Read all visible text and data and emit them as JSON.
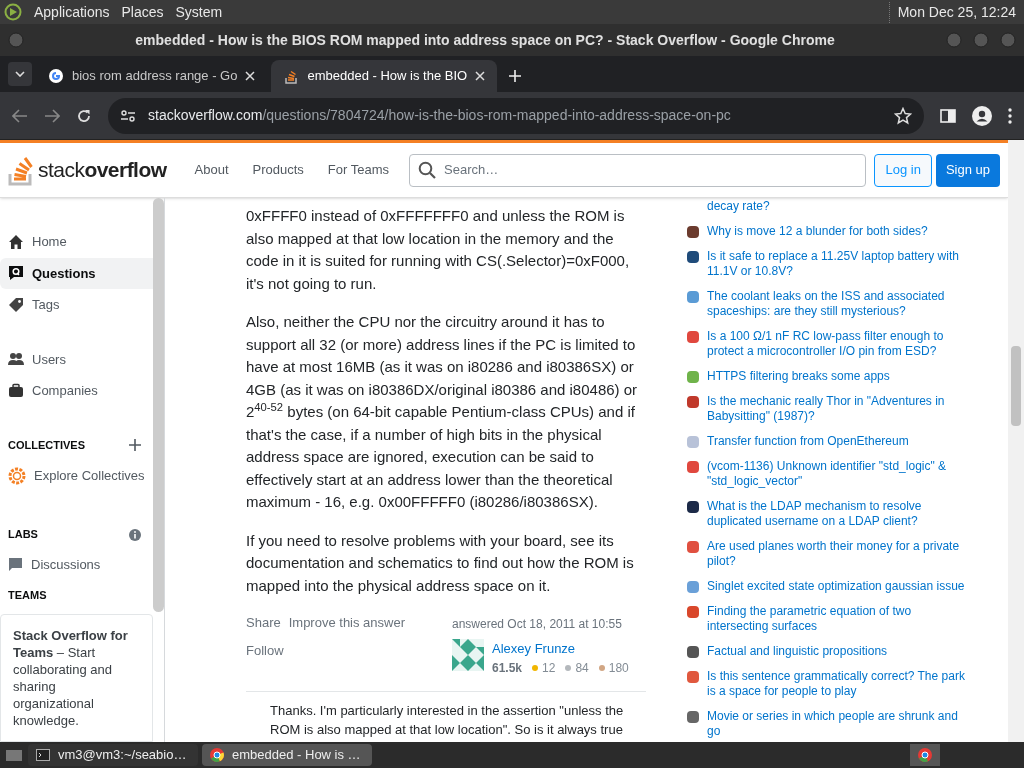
{
  "desktop_bar": {
    "menus": [
      "Applications",
      "Places",
      "System"
    ],
    "clock": "Mon Dec 25, 12:24"
  },
  "window": {
    "title": "embedded - How is the BIOS ROM mapped into address space on PC? - Stack Overflow - Google Chrome"
  },
  "tabs": [
    {
      "label": "bios rom address range - Go",
      "selected": false,
      "kind": "google"
    },
    {
      "label": "embedded - How is the BIO",
      "selected": true,
      "kind": "so"
    }
  ],
  "address_bar": {
    "host": "stackoverflow.com",
    "path": "/questions/7804724/how-is-the-bios-rom-mapped-into-address-space-on-pc"
  },
  "header": {
    "logo_light": "stack",
    "logo_bold": "overflow",
    "nav": [
      "About",
      "Products",
      "For Teams"
    ],
    "search_placeholder": "Search…",
    "login": "Log in",
    "signup": "Sign up"
  },
  "sidebar": {
    "items": [
      {
        "label": "Home",
        "selected": false
      },
      {
        "label": "Questions",
        "selected": true
      },
      {
        "label": "Tags",
        "selected": false
      },
      {
        "label": "Users",
        "selected": false
      },
      {
        "label": "Companies",
        "selected": false
      }
    ],
    "collectives_heading": "COLLECTIVES",
    "explore": "Explore Collectives",
    "labs_heading": "LABS",
    "discussions": "Discussions",
    "teams_heading": "TEAMS",
    "teams_text": "**Stack Overflow for Teams** – Start collaborating and sharing organizational knowledge."
  },
  "answer": {
    "paragraphs": [
      "0xFFFF0 instead of 0xFFFFFFF0 and unless the ROM is also mapped at that low location in the memory and the code in it is suited for running with CS(.Selector)=0xF000, it's not going to run.",
      "Also, neither the CPU nor the circuitry around it has to support all 32 (or more) address lines if the PC is limited to have at most 16MB (as it was on i80286 and i80386SX) or 4GB (as it was on i80386DX/original i80386 and i80486) or 2$^{40-52}$ bytes (on 64-bit capable Pentium-class CPUs) and if that's the case, if a number of high bits in the physical address space are ignored, execution can be said to effectively start at an address lower than the theoretical maximum - 16, e.g. 0x00FFFFF0 (i80286/i80386SX).",
      "If you need to resolve problems with your board, see its documentation and schematics to find out how the ROM is mapped into the physical address space on it."
    ],
    "actions": [
      "Share",
      "Improve this answer",
      "Follow"
    ],
    "answered": "answered Oct 18, 2011 at 10:55",
    "author": "Alexey Frunze",
    "reputation": "61.5k",
    "gold": "12",
    "silver": "84",
    "bronze": "180",
    "comment": "Thanks. I'm particularly interested in the assertion \"unless the ROM is also mapped at that low location\". So is it always true"
  },
  "hot_questions": [
    {
      "title": "decay rate?"
    },
    {
      "title": "Why is move 12 a blunder for both sides?",
      "color": "#6b3b2e"
    },
    {
      "title": "Is it safe to replace a 11.25V laptop battery with 11.1V or 10.8V?",
      "color": "#1f4b7a"
    },
    {
      "title": "The coolant leaks on the ISS and associated spaceships: are they still mysterious?",
      "color": "#5a9bd5"
    },
    {
      "title": "Is a 100 Ω/1 nF RC low-pass filter enough to protect a microcontroller I/O pin from ESD?",
      "color": "#e0483e"
    },
    {
      "title": "HTTPS filtering breaks some apps",
      "color": "#6fb34a"
    },
    {
      "title": "Is the mechanic really Thor in \"Adventures in Babysitting\" (1987)?",
      "color": "#c0392b"
    },
    {
      "title": "Transfer function from OpenEthereum",
      "color": "#b8c2d8"
    },
    {
      "title": "(vcom-1136) Unknown identifier \"std_logic\" & \"std_logic_vector\"",
      "color": "#e0483e"
    },
    {
      "title": "What is the LDAP mechanism to resolve duplicated username on a LDAP client?",
      "color": "#1c2a48"
    },
    {
      "title": "Are used planes worth their money for a private pilot?",
      "color": "#e05040"
    },
    {
      "title": "Singlet excited state optimization gaussian issue",
      "color": "#6aa0d8"
    },
    {
      "title": "Finding the parametric equation of two intersecting surfaces",
      "color": "#d9472b"
    },
    {
      "title": "Factual and linguistic propositions",
      "color": "#555555"
    },
    {
      "title": "Is this sentence grammatically correct? The park is a space for people to play",
      "color": "#e0583e"
    },
    {
      "title": "Movie or series in which people are shrunk and go",
      "color": "#666666"
    }
  ],
  "taskbar": {
    "items": [
      {
        "label": "vm3@vm3:~/seabio…",
        "selected": false,
        "kind": "terminal"
      },
      {
        "label": "embedded - How is …",
        "selected": true,
        "kind": "chrome"
      }
    ]
  }
}
